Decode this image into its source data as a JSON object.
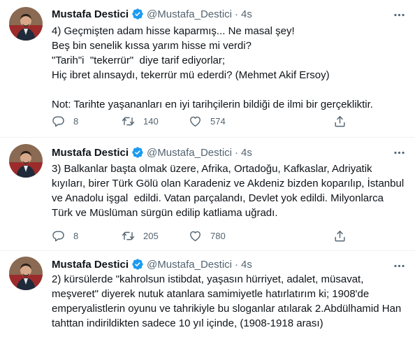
{
  "accent_color": "#1d9bf0",
  "text_muted_color": "#536471",
  "tweets": [
    {
      "name": "Mustafa Destici",
      "handle": "@Mustafa_Destici",
      "separator": "·",
      "time": "4s",
      "text": "4) Geçmişten adam hisse kaparmış... Ne masal şey!\nBeş bin senelik kıssa yarım hisse mi verdi?\n\"Tarih\"i  \"tekerrür\"  diye tarif ediyorlar;\nHiç ibret alınsaydı, tekerrür mü ederdi? (Mehmet Akif Ersoy)\n\nNot: Tarihte yaşananları en iyi tarihçilerin bildiği de ilmi bir gerçekliktir.",
      "replies": "8",
      "retweets": "140",
      "likes": "574"
    },
    {
      "name": "Mustafa Destici",
      "handle": "@Mustafa_Destici",
      "separator": "·",
      "time": "4s",
      "text": "3) Balkanlar başta olmak üzere, Afrika, Ortadoğu, Kafkaslar, Adriyatik\nkıyıları, birer Türk Gölü olan Karadeniz ve Akdeniz bizden koparılıp, İstanbul\nve Anadolu işgal  edildi. Vatan parçalandı, Devlet yok edildi. Milyonlarca\nTürk ve Müslüman sürgün edilip katliama uğradı.",
      "replies": "8",
      "retweets": "205",
      "likes": "780"
    },
    {
      "name": "Mustafa Destici",
      "handle": "@Mustafa_Destici",
      "separator": "·",
      "time": "4s",
      "text": "2) kürsülerde \"kahrolsun istibdat, yaşasın hürriyet, adalet, müsavat,\nmeşveret\" diyerek nutuk atanlara samimiyetle hatırlatırım ki; 1908'de\nemperyalistlerin oyunu ve tahrikiyle bu sloganlar atılarak 2.Abdülhamid Han\ntahttan indirildikten sadece 10 yıl içinde, (1908-1918 arası)"
    }
  ]
}
